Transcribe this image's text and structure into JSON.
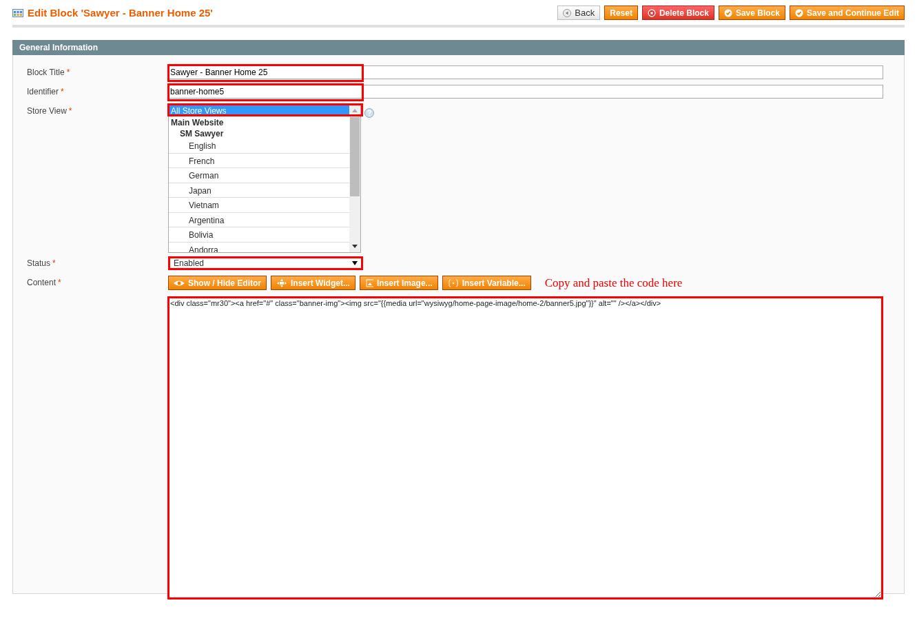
{
  "page_title": "Edit Block 'Sawyer - Banner Home 25'",
  "actions": [
    {
      "label": "Back",
      "kind": "back"
    },
    {
      "label": "Reset",
      "kind": "plain"
    },
    {
      "label": "Delete Block",
      "kind": "delete"
    },
    {
      "label": "Save Block",
      "kind": "save"
    },
    {
      "label": "Save and Continue Edit",
      "kind": "save"
    }
  ],
  "section": {
    "title": "General Information"
  },
  "fields": [
    {
      "label": "Block Title",
      "required": "*",
      "kind": "text",
      "value": "Sawyer - Banner Home 25",
      "highlighted": true
    },
    {
      "label": "Identifier",
      "required": "*",
      "kind": "text",
      "value": "banner-home5",
      "highlighted": true
    },
    {
      "label": "Store View",
      "required": "*",
      "kind": "multiselect",
      "highlighted": true,
      "options": [
        {
          "label": "All Store Views",
          "selected": true
        },
        {
          "label": "Main Website",
          "children": [
            {
              "label": "SM Sawyer",
              "children": [
                {
                  "label": "English",
                  "selected": false
                },
                {
                  "label": "French",
                  "selected": false
                },
                {
                  "label": "German",
                  "selected": false
                },
                {
                  "label": "Japan",
                  "selected": false
                },
                {
                  "label": "Vietnam",
                  "selected": false
                },
                {
                  "label": "Argentina",
                  "selected": false
                },
                {
                  "label": "Bolivia",
                  "selected": false
                },
                {
                  "label": "Andorra",
                  "selected": false
                }
              ]
            }
          ]
        }
      ]
    },
    {
      "label": "Status",
      "required": "*",
      "kind": "select",
      "value": "Enabled",
      "highlighted": true
    },
    {
      "label": "Content",
      "required": "*",
      "kind": "editor",
      "highlighted": true,
      "tools": [
        {
          "label": "Show / Hide Editor",
          "kind": "eye"
        },
        {
          "label": "Insert Widget...",
          "kind": "widget"
        },
        {
          "label": "Insert Image...",
          "kind": "image"
        },
        {
          "label": "Insert Variable...",
          "kind": "variable"
        }
      ],
      "annotation": "Copy and paste the code here",
      "value": "<div class=\"mr30\"><a href=\"#\" class=\"banner-img\"><img src=\"{{media url=\"wysiwyg/home-page-image/home-2/banner5.jpg\"}}\" alt=\"\" /></a></div>"
    }
  ]
}
